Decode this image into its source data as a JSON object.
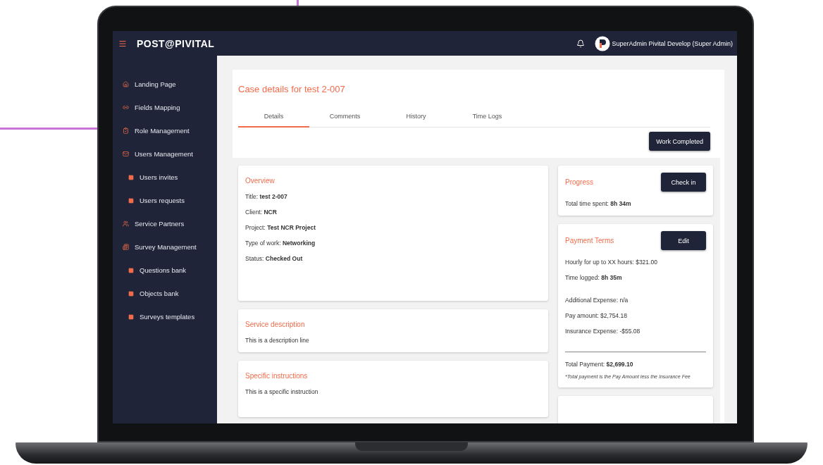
{
  "header": {
    "logo": "POST@PIVITAL",
    "user": "SuperAdmin Pivital Develop (Super Admin)"
  },
  "sidebar": {
    "items": [
      {
        "label": "Landing Page"
      },
      {
        "label": "Fields Mapping"
      },
      {
        "label": "Role Management"
      },
      {
        "label": "Users Management",
        "children": [
          {
            "label": "Users invites"
          },
          {
            "label": "Users requests"
          }
        ]
      },
      {
        "label": "Service Partners"
      },
      {
        "label": "Survey Management",
        "children": [
          {
            "label": "Questions bank"
          },
          {
            "label": "Objects bank"
          },
          {
            "label": "Surveys templates"
          }
        ]
      }
    ]
  },
  "page": {
    "title": "Case details for test 2-007",
    "tabs": [
      {
        "label": "Details",
        "selected": true
      },
      {
        "label": "Comments",
        "selected": false
      },
      {
        "label": "History",
        "selected": false
      },
      {
        "label": "Time Logs",
        "selected": false
      }
    ],
    "action": "Work Completed"
  },
  "overview": {
    "title": "Overview",
    "lines": [
      "Title: **test 2-007**",
      "Client: **NCR**",
      "Project: **Test NCR Project**",
      "Type of work: **Networking**",
      "Status: **Checked Out**"
    ]
  },
  "service_description": {
    "title": "Service description",
    "text": "This is a description line"
  },
  "specific_instructions": {
    "title": "Specific instructions",
    "text": "This is a specific instruction"
  },
  "progress": {
    "title": "Progress",
    "button": "Check in",
    "text": "Total time spent: **8h 34m**"
  },
  "payment_terms": {
    "title": "Payment Terms",
    "button": "Edit",
    "groups": [
      [
        "Hourly for up to XX hours: $321.00",
        "Time logged: **8h 35m**"
      ],
      [
        "Additional Expense: n/a",
        "Pay amount: $2,754.18",
        "Insurance Expense: -$55.08"
      ]
    ],
    "total": "Total Payment: **$2,699.10**",
    "note": "*Total payment is the Pay Amount less the Insurance Fee"
  }
}
